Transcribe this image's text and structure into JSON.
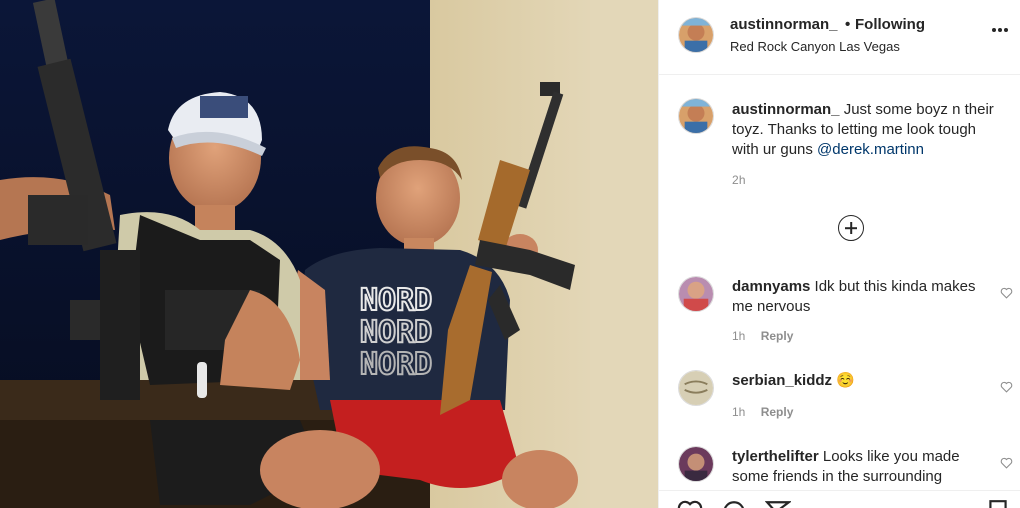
{
  "header": {
    "username": "austinnorman_",
    "separator": "•",
    "follow_status": "Following",
    "location": "Red Rock Canyon Las Vegas"
  },
  "caption": {
    "username": "austinnorman_",
    "text": "Just some boyz n their toyz. Thanks to letting me look tough with ur guns",
    "mention": "@derek.martinn",
    "age": "2h"
  },
  "comments": [
    {
      "username": "damnyams",
      "text": "Idk but this kinda makes me nervous",
      "age": "1h",
      "reply_label": "Reply"
    },
    {
      "username": "serbian_kiddz",
      "text": "☺️",
      "age": "1h",
      "reply_label": "Reply"
    },
    {
      "username": "tylerthelifter",
      "text": "Looks like you made some friends in the surrounding",
      "age": "",
      "reply_label": ""
    }
  ],
  "photo": {
    "shirt_text": "NORD"
  },
  "icons": {
    "more": "more-options-icon",
    "load_more": "plus-circle-icon",
    "like": "heart-icon",
    "comment": "comment-icon",
    "share": "paper-plane-icon",
    "save": "bookmark-icon"
  },
  "colors": {
    "text": "#262626",
    "secondary": "#8e8e8e",
    "link": "#00376b",
    "border": "#efefef"
  }
}
